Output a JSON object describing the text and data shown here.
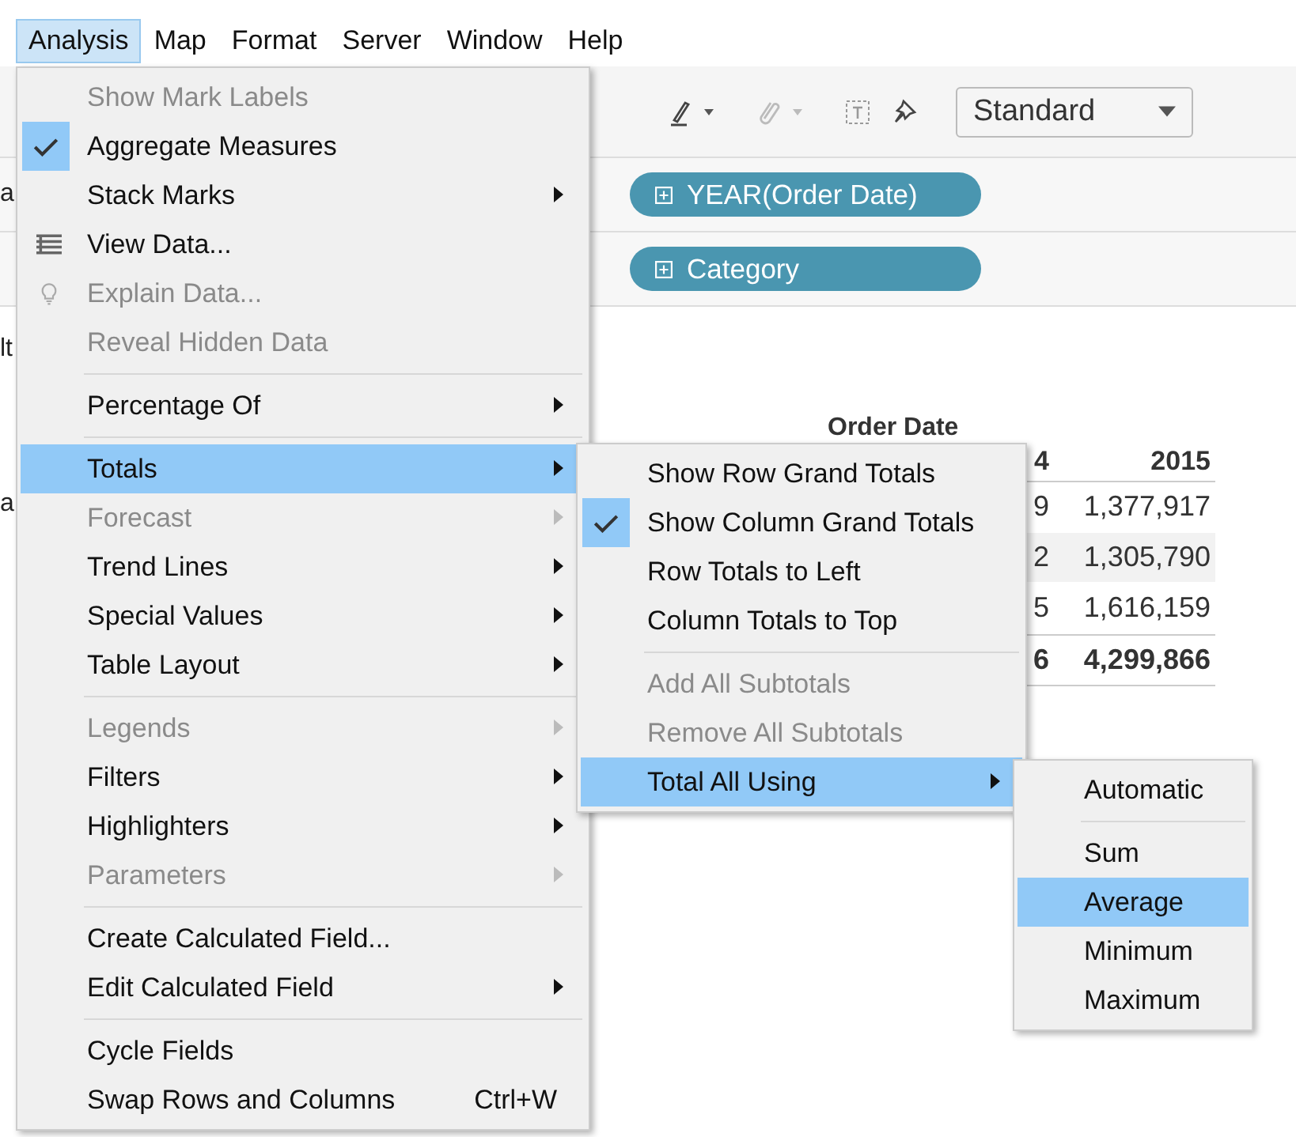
{
  "menu_bar": [
    {
      "label": "Analysis",
      "selected": true
    },
    {
      "label": "Map",
      "selected": false
    },
    {
      "label": "Format",
      "selected": false
    },
    {
      "label": "Server",
      "selected": false
    },
    {
      "label": "Window",
      "selected": false
    },
    {
      "label": "Help",
      "selected": false
    }
  ],
  "toolbar": {
    "view_size": "Standard"
  },
  "shelves": [
    {
      "pill": "YEAR(Order Date)"
    },
    {
      "pill": "Category"
    }
  ],
  "left_pane_fragments": [
    "a",
    "lt",
    "a"
  ],
  "table": {
    "header": "Order Date",
    "columns": [
      "4",
      "2015"
    ],
    "rows": [
      {
        "cells": [
          "9",
          "1,377,917"
        ],
        "kind": "row"
      },
      {
        "cells": [
          "2",
          "1,305,790"
        ],
        "kind": "band"
      },
      {
        "cells": [
          "5",
          "1,616,159"
        ],
        "kind": "row"
      },
      {
        "cells": [
          "6",
          "4,299,866"
        ],
        "kind": "total"
      }
    ]
  },
  "analysis_menu": [
    {
      "kind": "item",
      "label": "Show Mark Labels",
      "disabled": true,
      "checked": false,
      "submenu": false,
      "selected": false
    },
    {
      "kind": "item",
      "label": "Aggregate Measures",
      "disabled": false,
      "checked": true,
      "submenu": false,
      "selected": false
    },
    {
      "kind": "item",
      "label": "Stack Marks",
      "disabled": false,
      "checked": false,
      "submenu": true,
      "selected": false
    },
    {
      "kind": "item",
      "label": "View Data...",
      "disabled": false,
      "checked": false,
      "submenu": false,
      "selected": false
    },
    {
      "kind": "item",
      "label": "Explain Data...",
      "disabled": true,
      "checked": false,
      "submenu": false,
      "selected": false
    },
    {
      "kind": "item",
      "label": "Reveal Hidden Data",
      "disabled": true,
      "checked": false,
      "submenu": false,
      "selected": false
    },
    {
      "kind": "separator"
    },
    {
      "kind": "item",
      "label": "Percentage Of",
      "disabled": false,
      "checked": false,
      "submenu": true,
      "selected": false
    },
    {
      "kind": "separator"
    },
    {
      "kind": "item",
      "label": "Totals",
      "disabled": false,
      "checked": false,
      "submenu": true,
      "selected": true
    },
    {
      "kind": "item",
      "label": "Forecast",
      "disabled": true,
      "checked": false,
      "submenu": true,
      "selected": false
    },
    {
      "kind": "item",
      "label": "Trend Lines",
      "disabled": false,
      "checked": false,
      "submenu": true,
      "selected": false
    },
    {
      "kind": "item",
      "label": "Special Values",
      "disabled": false,
      "checked": false,
      "submenu": true,
      "selected": false
    },
    {
      "kind": "item",
      "label": "Table Layout",
      "disabled": false,
      "checked": false,
      "submenu": true,
      "selected": false
    },
    {
      "kind": "separator"
    },
    {
      "kind": "item",
      "label": "Legends",
      "disabled": true,
      "checked": false,
      "submenu": true,
      "selected": false
    },
    {
      "kind": "item",
      "label": "Filters",
      "disabled": false,
      "checked": false,
      "submenu": true,
      "selected": false
    },
    {
      "kind": "item",
      "label": "Highlighters",
      "disabled": false,
      "checked": false,
      "submenu": true,
      "selected": false
    },
    {
      "kind": "item",
      "label": "Parameters",
      "disabled": true,
      "checked": false,
      "submenu": true,
      "selected": false
    },
    {
      "kind": "separator"
    },
    {
      "kind": "item",
      "label": "Create Calculated Field...",
      "disabled": false,
      "checked": false,
      "submenu": false,
      "selected": false
    },
    {
      "kind": "item",
      "label": "Edit Calculated Field",
      "disabled": false,
      "checked": false,
      "submenu": true,
      "selected": false
    },
    {
      "kind": "separator"
    },
    {
      "kind": "item",
      "label": "Cycle Fields",
      "disabled": false,
      "checked": false,
      "submenu": false,
      "selected": false
    },
    {
      "kind": "item",
      "label": "Swap Rows and Columns",
      "disabled": false,
      "checked": false,
      "submenu": false,
      "selected": false,
      "shortcut": "Ctrl+W"
    }
  ],
  "totals_menu": [
    {
      "kind": "item",
      "label": "Show Row Grand Totals",
      "disabled": false,
      "checked": false,
      "submenu": false,
      "selected": false
    },
    {
      "kind": "item",
      "label": "Show Column Grand Totals",
      "disabled": false,
      "checked": true,
      "submenu": false,
      "selected": false
    },
    {
      "kind": "item",
      "label": "Row Totals to Left",
      "disabled": false,
      "checked": false,
      "submenu": false,
      "selected": false
    },
    {
      "kind": "item",
      "label": "Column Totals to Top",
      "disabled": false,
      "checked": false,
      "submenu": false,
      "selected": false
    },
    {
      "kind": "separator"
    },
    {
      "kind": "item",
      "label": "Add All Subtotals",
      "disabled": true,
      "checked": false,
      "submenu": false,
      "selected": false
    },
    {
      "kind": "item",
      "label": "Remove All Subtotals",
      "disabled": true,
      "checked": false,
      "submenu": false,
      "selected": false
    },
    {
      "kind": "item",
      "label": "Total All Using",
      "disabled": false,
      "checked": false,
      "submenu": true,
      "selected": true
    }
  ],
  "total_using_menu": [
    {
      "kind": "item",
      "label": "Automatic",
      "disabled": false,
      "checked": false,
      "submenu": false,
      "selected": false
    },
    {
      "kind": "separator"
    },
    {
      "kind": "item",
      "label": "Sum",
      "disabled": false,
      "checked": false,
      "submenu": false,
      "selected": false
    },
    {
      "kind": "item",
      "label": "Average",
      "disabled": false,
      "checked": false,
      "submenu": false,
      "selected": true
    },
    {
      "kind": "item",
      "label": "Minimum",
      "disabled": false,
      "checked": false,
      "submenu": false,
      "selected": false
    },
    {
      "kind": "item",
      "label": "Maximum",
      "disabled": false,
      "checked": false,
      "submenu": false,
      "selected": false
    }
  ]
}
